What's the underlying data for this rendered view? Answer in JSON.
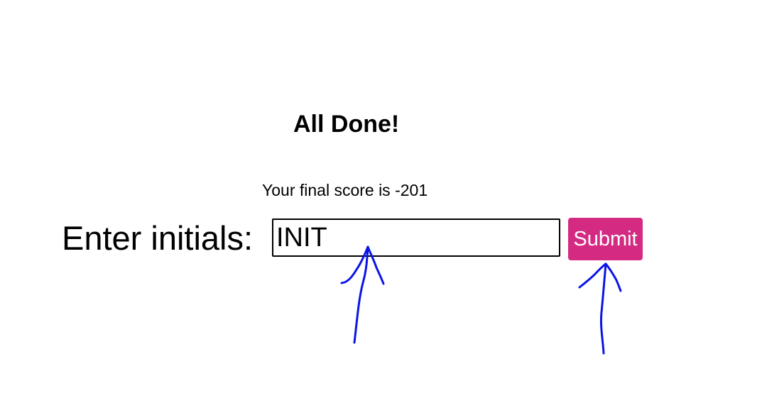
{
  "done": {
    "title": "All Done!",
    "score_text": "Your final score is -201"
  },
  "form": {
    "label": "Enter initials:",
    "input_value": "INIT",
    "submit_label": "Submit"
  },
  "colors": {
    "submit_bg": "#d42a82",
    "annotation_ink": "#0a14e6"
  }
}
